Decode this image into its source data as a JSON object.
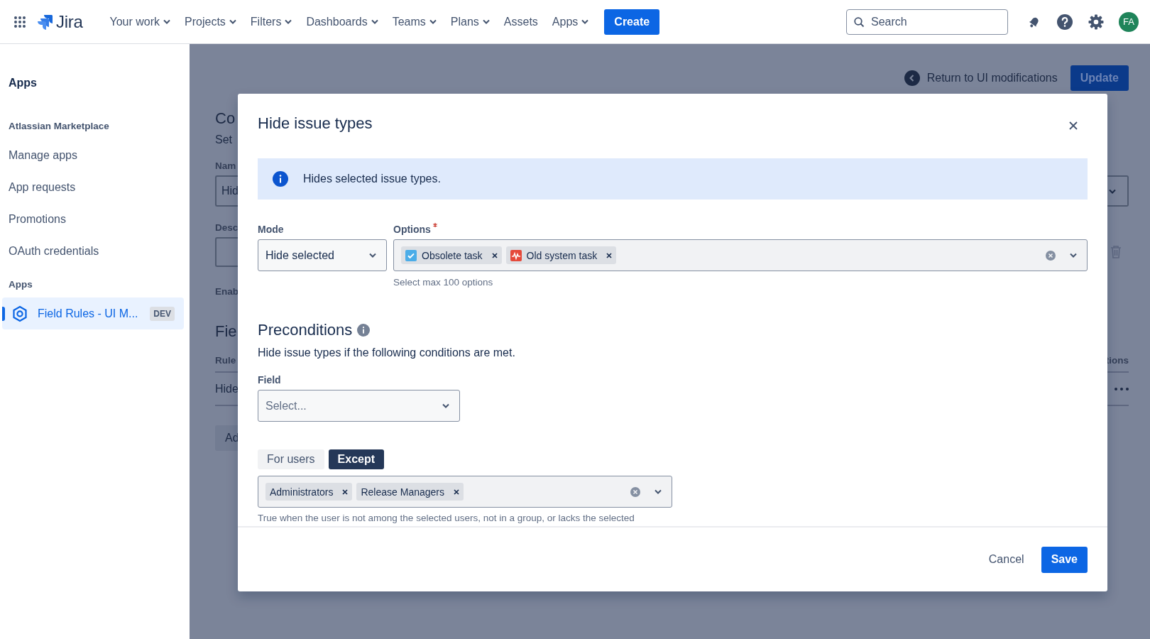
{
  "top_nav": {
    "logo": "Jira",
    "menu": [
      {
        "label": "Your work",
        "dropdown": true
      },
      {
        "label": "Projects",
        "dropdown": true
      },
      {
        "label": "Filters",
        "dropdown": true
      },
      {
        "label": "Dashboards",
        "dropdown": true
      },
      {
        "label": "Teams",
        "dropdown": true
      },
      {
        "label": "Plans",
        "dropdown": true
      },
      {
        "label": "Assets",
        "dropdown": false
      },
      {
        "label": "Apps",
        "dropdown": true
      }
    ],
    "create_button": "Create",
    "search": {
      "placeholder": "Search"
    },
    "avatar": "FA"
  },
  "sidebar": {
    "title": "Apps",
    "sections": [
      {
        "heading": "Atlassian Marketplace",
        "items": [
          {
            "label": "Manage apps",
            "selected": false
          },
          {
            "label": "App requests",
            "selected": false
          },
          {
            "label": "Promotions",
            "selected": false
          },
          {
            "label": "OAuth credentials",
            "selected": false
          }
        ]
      },
      {
        "heading": "Apps",
        "items": [
          {
            "label": "Field Rules - UI M...",
            "badge": "DEV",
            "selected": true
          }
        ]
      }
    ]
  },
  "background_page": {
    "return_link": "Return to UI modifications",
    "update_button": "Update",
    "heading": "Co",
    "subtitle": "Set",
    "name_label": "Nam",
    "name_value": "Hid",
    "description_label": "Desc",
    "enabled_label": "Enab",
    "section_heading": "Fie",
    "column_header": "Rule",
    "row_cell": "Hide",
    "add_button": "Ad",
    "actions_header": "tions"
  },
  "modal": {
    "title": "Hide issue types",
    "info": "Hides selected issue types.",
    "mode": {
      "label": "Mode",
      "value": "Hide selected"
    },
    "options": {
      "label": "Options",
      "required": true,
      "tags": [
        {
          "label": "Obsolete task",
          "kind": "check"
        },
        {
          "label": "Old system task",
          "kind": "pulse"
        }
      ],
      "helper": "Select max 100 options"
    },
    "preconditions": {
      "heading": "Preconditions",
      "description": "Hide issue types if the following conditions are met.",
      "field": {
        "label": "Field",
        "placeholder": "Select..."
      },
      "tabs": [
        {
          "label": "For users",
          "selected": false
        },
        {
          "label": "Except",
          "selected": true
        }
      ],
      "users": [
        {
          "label": "Administrators"
        },
        {
          "label": "Release Managers"
        }
      ],
      "helper": "True when the user is not among the selected users, not in a group, or lacks the selected"
    },
    "footer": {
      "cancel": "Cancel",
      "save": "Save"
    }
  }
}
